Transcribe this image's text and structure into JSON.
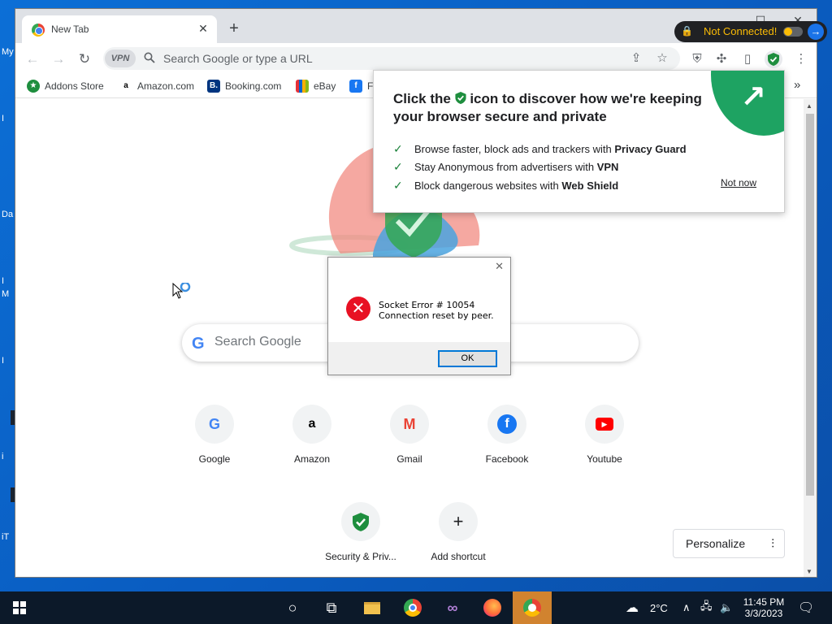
{
  "desktop": {
    "labels": [
      "My",
      "I",
      "Da",
      "I",
      "M",
      "I",
      "i",
      "iT"
    ]
  },
  "browser": {
    "tab": {
      "title": "New Tab",
      "close": "✕"
    },
    "new_tab": "+",
    "window_controls": {
      "minimize": "—",
      "maximize": "☐",
      "close": "✕"
    },
    "toolbar": {
      "vpn_badge": "VPN",
      "omnibox_placeholder": "Search Google or type a URL"
    },
    "bookmarks": [
      {
        "label": "Addons Store",
        "icon": "addons-store-icon"
      },
      {
        "label": "Amazon.com",
        "icon": "amazon-icon"
      },
      {
        "label": "Booking.com",
        "icon": "booking-icon"
      },
      {
        "label": "eBay",
        "icon": "ebay-icon"
      },
      {
        "label": "Fa",
        "icon": "facebook-icon"
      }
    ],
    "bookmarks_more": "»",
    "vpn_widget": {
      "status": "Not Connected!"
    },
    "promo": {
      "heading_before": "Click the",
      "heading_after": "icon to discover how we're keeping your browser secure and private",
      "items": [
        {
          "text": "Browse faster, block ads and trackers with ",
          "bold": "Privacy Guard"
        },
        {
          "text": "Stay Anonymous from advertisers with ",
          "bold": "VPN"
        },
        {
          "text": "Block dangerous websites with ",
          "bold": "Web Shield"
        }
      ],
      "dismiss": "Not now",
      "accent": "#1ea362"
    },
    "newtab": {
      "search_placeholder": "Search Google",
      "shortcuts": [
        {
          "label": "Google",
          "icon": "google-icon"
        },
        {
          "label": "Amazon",
          "icon": "amazon-icon"
        },
        {
          "label": "Gmail",
          "icon": "gmail-icon"
        },
        {
          "label": "Facebook",
          "icon": "facebook-icon"
        },
        {
          "label": "Youtube",
          "icon": "youtube-icon"
        },
        {
          "label": "Security & Priv...",
          "icon": "shield-icon"
        },
        {
          "label": "Add shortcut",
          "icon": "plus-icon"
        }
      ],
      "personalize": "Personalize"
    }
  },
  "error_dialog": {
    "title_line": "Socket Error # 10054",
    "message": "Connection reset by peer.",
    "ok": "OK"
  },
  "taskbar": {
    "weather": "2°C",
    "time": "11:45 PM",
    "date": "3/3/2023"
  }
}
